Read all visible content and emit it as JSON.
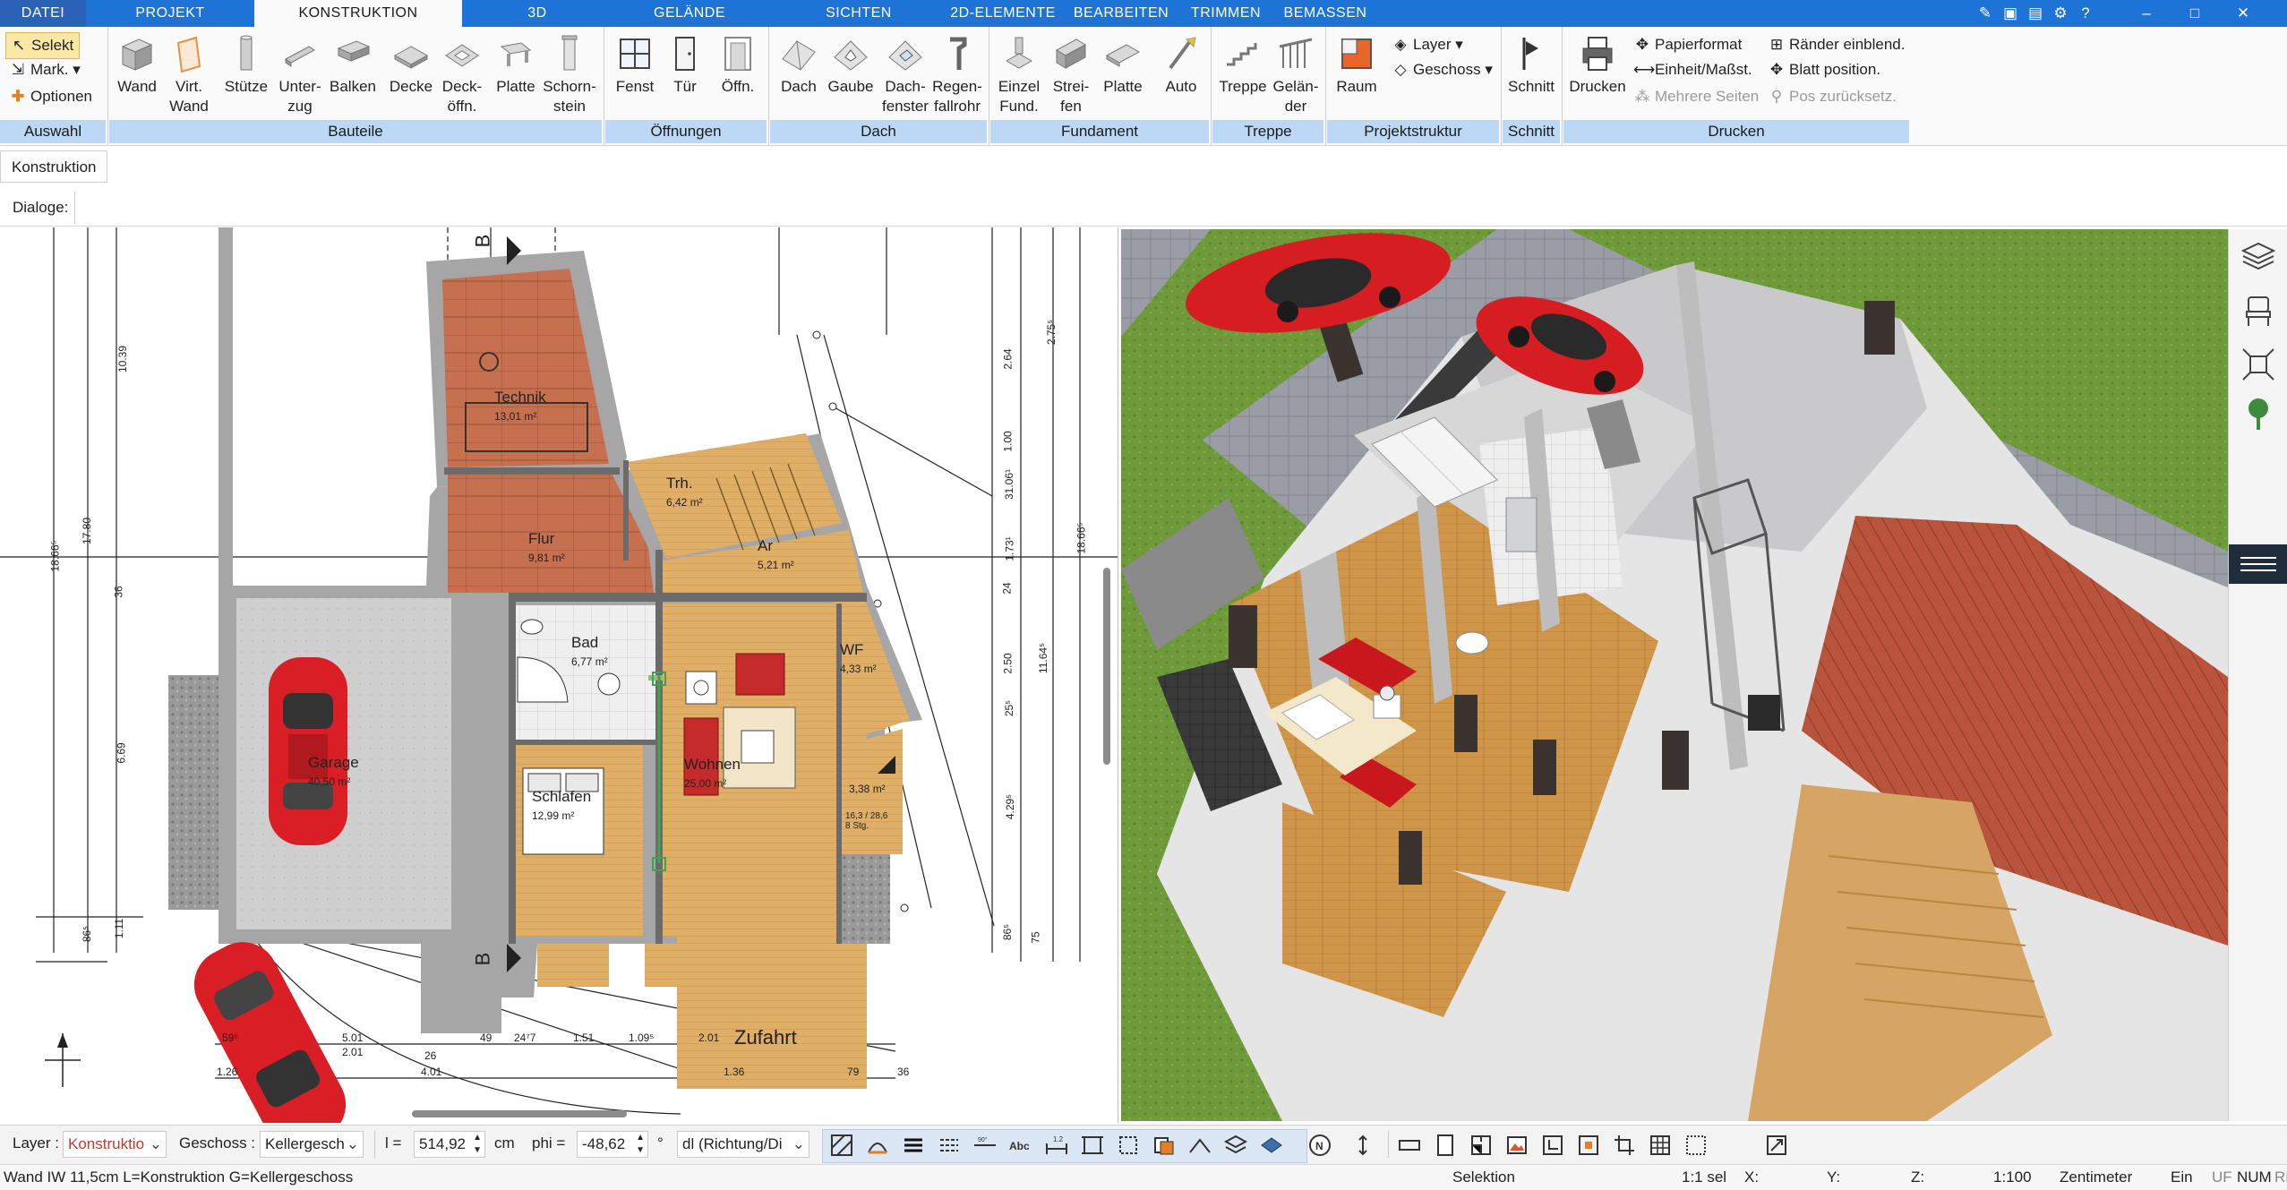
{
  "tabs": [
    {
      "label": "DATEI"
    },
    {
      "label": "PROJEKT"
    },
    {
      "label": "KONSTRUKTION"
    },
    {
      "label": "3D"
    },
    {
      "label": "GELÄNDE"
    },
    {
      "label": "SICHTEN"
    },
    {
      "label": "2D-ELEMENTE"
    },
    {
      "label": "BEARBEITEN"
    },
    {
      "label": "TRIMMEN"
    },
    {
      "label": "BEMASSEN"
    }
  ],
  "ribbon": {
    "auswahl": {
      "selekt": "Selekt",
      "mark": "Mark.",
      "optionen": "Optionen",
      "footer": "Auswahl"
    },
    "bauteile": {
      "footer": "Bauteile",
      "buttons": [
        {
          "l1": "Wand",
          "l2": ""
        },
        {
          "l1": "Virt.",
          "l2": "Wand"
        },
        {
          "l1": "Stütze",
          "l2": ""
        },
        {
          "l1": "Unter-",
          "l2": "zug"
        },
        {
          "l1": "Balken",
          "l2": ""
        },
        {
          "l1": "Decke",
          "l2": ""
        },
        {
          "l1": "Deck-",
          "l2": "öffn."
        },
        {
          "l1": "Platte",
          "l2": ""
        },
        {
          "l1": "Schorn-",
          "l2": "stein"
        }
      ]
    },
    "oeffnungen": {
      "footer": "Öffnungen",
      "buttons": [
        {
          "l1": "Fenst"
        },
        {
          "l1": "Tür"
        },
        {
          "l1": "Öffn."
        }
      ]
    },
    "dach": {
      "footer": "Dach",
      "buttons": [
        {
          "l1": "Dach",
          "l2": ""
        },
        {
          "l1": "Gaube",
          "l2": ""
        },
        {
          "l1": "Dach-",
          "l2": "fenster"
        },
        {
          "l1": "Regen-",
          "l2": "fallrohr"
        }
      ]
    },
    "fundament": {
      "footer": "Fundament",
      "buttons": [
        {
          "l1": "Einzel",
          "l2": "Fund."
        },
        {
          "l1": "Strei-",
          "l2": "fen"
        },
        {
          "l1": "Platte",
          "l2": ""
        },
        {
          "l1": "Auto",
          "l2": ""
        }
      ]
    },
    "treppe": {
      "footer": "Treppe",
      "buttons": [
        {
          "l1": "Treppe",
          "l2": ""
        },
        {
          "l1": "Gelän-",
          "l2": "der"
        }
      ]
    },
    "projektstruktur": {
      "footer": "Projektstruktur",
      "raum": "Raum",
      "layer": "Layer",
      "geschoss": "Geschoss"
    },
    "schnitt": {
      "footer": "Schnitt",
      "label": "Schnitt"
    },
    "drucken": {
      "footer": "Drucken",
      "drucken": "Drucken",
      "papierformat": "Papierformat",
      "einheit": "Einheit/Maßst.",
      "mehrere": "Mehrere Seiten",
      "raender": "Ränder einblend.",
      "blatt": "Blatt position.",
      "pos": "Pos zurücksetz."
    }
  },
  "sublabel": "Konstruktion",
  "dialoge": "Dialoge:",
  "plan": {
    "rooms": [
      {
        "name": "Technik",
        "area": "13,01 m²"
      },
      {
        "name": "Trh.",
        "area": "6,42 m²"
      },
      {
        "name": "Flur",
        "area": "9,81 m²"
      },
      {
        "name": "Ar",
        "area": "5,21 m²"
      },
      {
        "name": "Bad",
        "area": "6,77 m²"
      },
      {
        "name": "WF",
        "area": "4,33 m²"
      },
      {
        "name": "Garage",
        "area": "40,50 m²"
      },
      {
        "name": "Wohnen",
        "area": "25,00 m²"
      },
      {
        "name": "Schlafen",
        "area": "12,99 m²"
      },
      {
        "name": "",
        "area": "3,38 m²"
      }
    ],
    "zufahrt": "Zufahrt",
    "section_label": "B",
    "dims_left": [
      "10.39",
      "17.80",
      "18.66⁵",
      "36",
      "6.69",
      "86⁵",
      "1.11"
    ],
    "dims_right": [
      "2.75⁵",
      "2.64",
      "1.00",
      "31.06¹",
      "1.73¹",
      "24",
      "2.50",
      "25⁵",
      "4.29⁵",
      "86⁵",
      "75",
      "11.64⁵",
      "18.66⁵"
    ],
    "dims_bottom": [
      "59⁵",
      "5.01",
      "2.01",
      "49",
      "24⁷7",
      "1.51",
      "1.09⁵",
      "2.01",
      "26",
      "4.01",
      "1.36",
      "79",
      "36",
      "1.26"
    ],
    "stair_small": "16,3 / 28,6",
    "stair_small2": "8 Stg."
  },
  "bottom": {
    "layer_label": "Layer :",
    "layer_value": "Konstruktio",
    "geschoss_label": "Geschoss :",
    "geschoss_value": "Kellergesch",
    "l_label": "l =",
    "l_value": "514,92",
    "l_unit": "cm",
    "phi_label": "phi =",
    "phi_value": "-48,62",
    "phi_unit": "°",
    "dl_value": "dl (Richtung/Di"
  },
  "status": {
    "left": "Wand IW 11,5cm L=Konstruktion G=Kellergeschoss",
    "mode": "Selektion",
    "sel": "1:1 sel",
    "x": "X:",
    "y": "Y:",
    "z": "Z:",
    "scale": "1:100",
    "unit": "Zentimeter",
    "ein": "Ein",
    "uf": "UF",
    "num": "NUM",
    "rf": "RF"
  },
  "colors": {
    "tabbar": "#1e73d6",
    "group_footer": "#bcd8f5",
    "selection": "#fbe7a6",
    "wall": "#a6a6a6",
    "terracotta": "#c8735a",
    "wood": "#dda85f"
  }
}
